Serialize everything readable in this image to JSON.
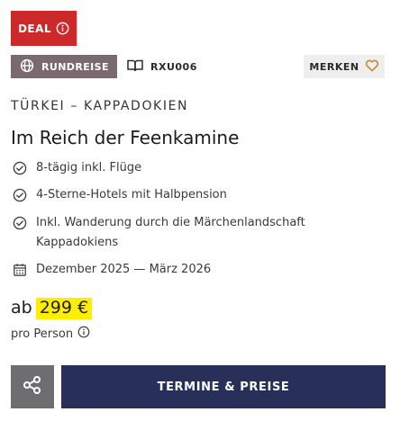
{
  "badge": {
    "label": "DEAL",
    "color": "#cc2a2a",
    "icon": "info-icon"
  },
  "trip_type": {
    "label": "RUNDREISE",
    "icon": "globe-icon"
  },
  "trip_code": {
    "label": "RXU006",
    "icon": "catalog-book-icon"
  },
  "wishlist": {
    "label": "MERKEN",
    "icon": "heart-icon"
  },
  "region": "TÜRKEI – KAPPADOKIEN",
  "title": "Im Reich der Feenkamine",
  "features": [
    {
      "icon": "check-circle-icon",
      "text": "8-tägig inkl. Flüge"
    },
    {
      "icon": "check-circle-icon",
      "text": "4-Sterne-Hotels mit Halbpension"
    },
    {
      "icon": "check-circle-icon",
      "text": "Inkl. Wanderung durch die Märchenlandschaft Kappadokiens"
    },
    {
      "icon": "calendar-icon",
      "text": "Dezember 2025 — März 2026"
    }
  ],
  "price": {
    "prefix": "ab",
    "amount": "299 €",
    "per": "pro Person",
    "highlight_color": "#ffee00"
  },
  "actions": {
    "share_icon": "share-icon",
    "cta_label": "TERMINE & PREISE",
    "cta_color": "#28305a"
  }
}
